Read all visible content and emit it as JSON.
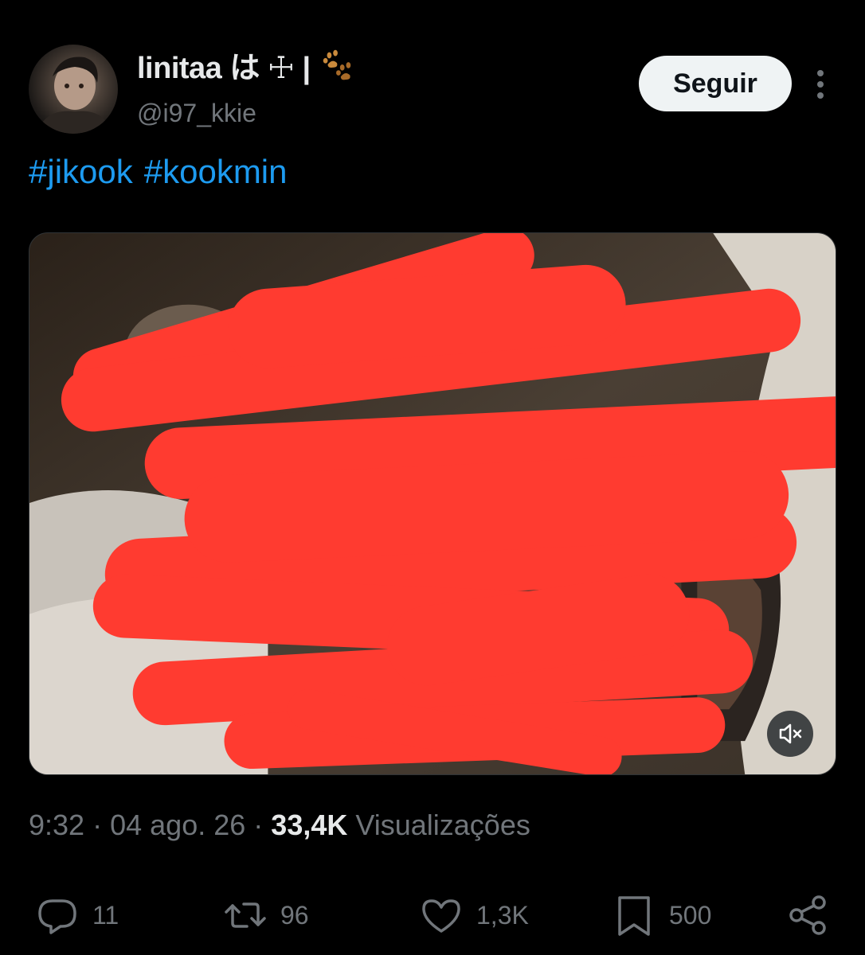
{
  "post": {
    "author": {
      "display_name": "linitaa は ☩ |",
      "handle": "@i97_kkie",
      "avatar_icon": "avatar-photo",
      "name_icon": "paw-prints-icon"
    },
    "follow_label": "Seguir",
    "hashtags": [
      "#jikook",
      "#kookmin"
    ],
    "media": {
      "type": "video",
      "muted": true,
      "redaction_color": "#ff3b30"
    },
    "meta": {
      "time": "9:32",
      "separator": "·",
      "date": "04 ago. 26",
      "views_count": "33,4K",
      "views_label": "Visualizações"
    },
    "actions": {
      "replies": "11",
      "reposts": "96",
      "likes": "1,3K",
      "bookmarks": "500"
    }
  },
  "colors": {
    "background": "#000000",
    "link": "#1d9bf0",
    "secondary_text": "#71767b",
    "primary_text": "#e7e9ea",
    "follow_button_bg": "#eff3f4"
  }
}
